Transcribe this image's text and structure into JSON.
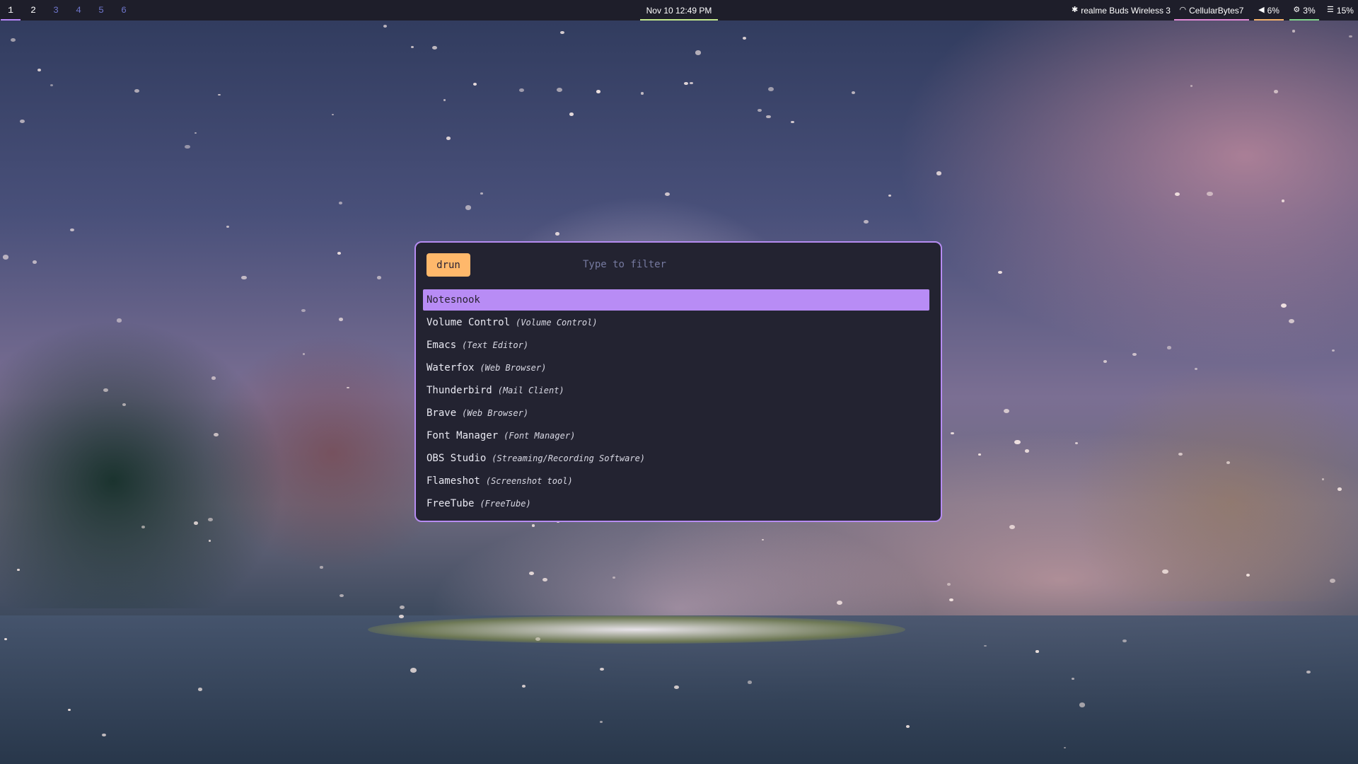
{
  "colors": {
    "bar_background": "#1e1e2a",
    "accent_purple": "#b887f8",
    "clock_underline": "#c3e88d",
    "wifi_underline": "#e28ad6",
    "volume_underline": "#f4b36b",
    "cpu_underline": "#7fd48a",
    "launcher_background": "#232331",
    "launcher_border": "#b68cf2",
    "mode_pill": "#ffb86b",
    "selected_row": "#b88cf5"
  },
  "topbar": {
    "workspaces": [
      {
        "label": "1",
        "state": "active"
      },
      {
        "label": "2",
        "state": "occupied"
      },
      {
        "label": "3",
        "state": "empty"
      },
      {
        "label": "4",
        "state": "empty"
      },
      {
        "label": "5",
        "state": "empty"
      },
      {
        "label": "6",
        "state": "empty"
      }
    ],
    "clock": "Nov 10  12:49 PM",
    "bluetooth": {
      "icon": "bluetooth-icon",
      "glyph": "✱",
      "label": "realme Buds Wireless 3"
    },
    "wifi": {
      "icon": "wifi-icon",
      "glyph": "◠",
      "label": "CellularBytes7"
    },
    "volume": {
      "icon": "volume-icon",
      "glyph": "◀",
      "label": "6%"
    },
    "cpu": {
      "icon": "cpu-icon",
      "glyph": "⚙",
      "label": "3%"
    },
    "memory": {
      "icon": "memory-icon",
      "glyph": "☰",
      "label": "15%"
    }
  },
  "launcher": {
    "mode": "drun",
    "filter_value": "",
    "filter_placeholder": "Type to filter",
    "results": [
      {
        "name": "Notesnook",
        "description": "",
        "selected": true
      },
      {
        "name": "Volume Control",
        "description": "(Volume Control)",
        "selected": false
      },
      {
        "name": "Emacs",
        "description": "(Text Editor)",
        "selected": false
      },
      {
        "name": "Waterfox",
        "description": "(Web Browser)",
        "selected": false
      },
      {
        "name": "Thunderbird",
        "description": "(Mail Client)",
        "selected": false
      },
      {
        "name": "Brave",
        "description": "(Web Browser)",
        "selected": false
      },
      {
        "name": "Font Manager",
        "description": "(Font Manager)",
        "selected": false
      },
      {
        "name": "OBS Studio",
        "description": "(Streaming/Recording Software)",
        "selected": false
      },
      {
        "name": "Flameshot",
        "description": "(Screenshot tool)",
        "selected": false
      },
      {
        "name": "FreeTube",
        "description": "(FreeTube)",
        "selected": false
      }
    ]
  }
}
